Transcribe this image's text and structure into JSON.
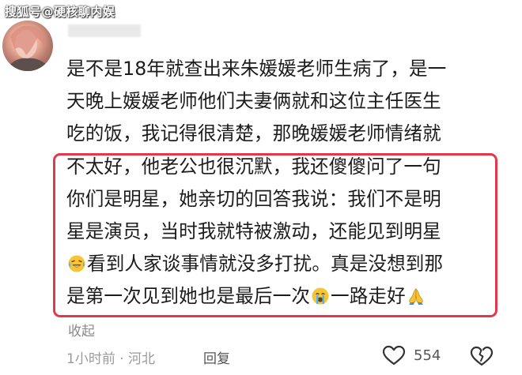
{
  "watermark": "搜狐号@硬核聊内娱",
  "comment": {
    "lines": [
      "是不是18年就查出来朱媛媛老师生病了，是一",
      "天晚上媛媛老师他们夫妻俩就和这位主任医生",
      "吃的饭，我记得很清楚，那晚媛媛老师情绪就",
      "不太好，他老公也很沉默，我还傻傻问了一句",
      "你们是明星，她亲切的回答我说：我们不是明",
      "星是演员，当时我就特被激动，还能见到明星",
      "看到人家谈事情就没多打扰。真是没想到那",
      "是第一次见到她也是最后一次",
      "一路走好"
    ],
    "emojis": [
      "laughing-tears-emoji",
      "crying-emoji",
      "praying-hands-emoji"
    ]
  },
  "actions": {
    "collapse": "收起",
    "meta": "1小时前 · 河北",
    "reply": "回复",
    "like_count": "554"
  },
  "colors": {
    "highlight": "#e3384a",
    "meta_text": "#9a9a9a"
  }
}
